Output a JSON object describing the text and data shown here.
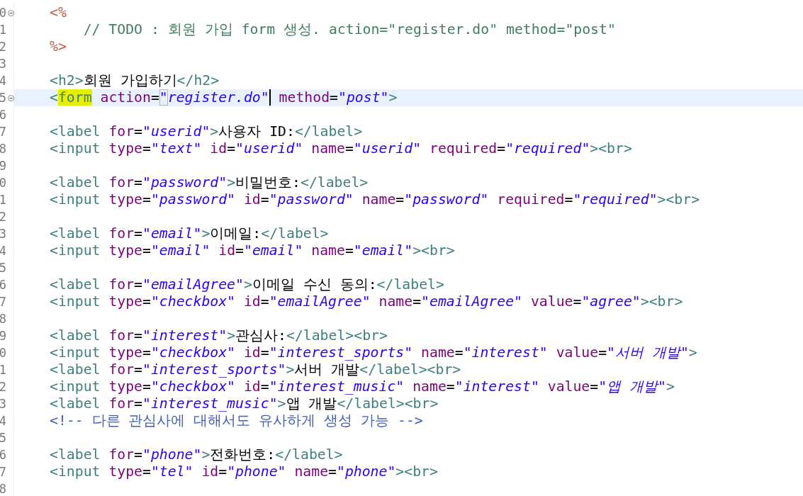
{
  "editor": {
    "lines": [
      {
        "number": "0",
        "fold": true,
        "current": false,
        "tokens": [
          {
            "kind": "jsp",
            "text": "<%"
          }
        ]
      },
      {
        "number": "1",
        "fold": false,
        "current": false,
        "tokens": [
          {
            "kind": "comment",
            "text": "    // TODO : 회원 가입 form 생성. action=\"register.do\" method=\"post\""
          }
        ]
      },
      {
        "number": "2",
        "fold": false,
        "current": false,
        "tokens": [
          {
            "kind": "jsp",
            "text": "%>"
          }
        ]
      },
      {
        "number": "3",
        "fold": false,
        "current": false
      },
      {
        "number": "4",
        "fold": false,
        "current": false,
        "tokens": [
          {
            "kind": "tag",
            "text": "<h2>"
          },
          {
            "kind": "text",
            "text": "회원 가입하기"
          },
          {
            "kind": "tag",
            "text": "</h2>"
          }
        ]
      },
      {
        "number": "5",
        "fold": true,
        "current": true,
        "tokens": [
          {
            "kind": "tag",
            "text": "<"
          },
          {
            "kind": "tag",
            "text": "form",
            "highlighted": true
          },
          {
            "kind": "attr",
            "text": " action"
          },
          {
            "kind": "text",
            "text": "="
          },
          {
            "kind": "value",
            "text": "\"",
            "boxed": true
          },
          {
            "kind": "value",
            "text": "register.do\"",
            "caret": true
          },
          {
            "kind": "attr",
            "text": " method"
          },
          {
            "kind": "text",
            "text": "="
          },
          {
            "kind": "value",
            "text": "\"post\""
          },
          {
            "kind": "tag",
            "text": ">"
          }
        ]
      },
      {
        "number": "6",
        "fold": false,
        "current": false
      },
      {
        "number": "7",
        "fold": false,
        "current": false,
        "tokens": [
          {
            "kind": "tag",
            "text": "<label"
          },
          {
            "kind": "attr",
            "text": " for"
          },
          {
            "kind": "text",
            "text": "="
          },
          {
            "kind": "value",
            "text": "\"userid\""
          },
          {
            "kind": "tag",
            "text": ">"
          },
          {
            "kind": "text",
            "text": "사용자 ID:"
          },
          {
            "kind": "tag",
            "text": "</label>"
          }
        ]
      },
      {
        "number": "8",
        "fold": false,
        "current": false,
        "tokens": [
          {
            "kind": "tag",
            "text": "<input"
          },
          {
            "kind": "attr",
            "text": " type"
          },
          {
            "kind": "text",
            "text": "="
          },
          {
            "kind": "value",
            "text": "\"text\""
          },
          {
            "kind": "attr",
            "text": " id"
          },
          {
            "kind": "text",
            "text": "="
          },
          {
            "kind": "value",
            "text": "\"userid\""
          },
          {
            "kind": "attr",
            "text": " name"
          },
          {
            "kind": "text",
            "text": "="
          },
          {
            "kind": "value",
            "text": "\"userid\""
          },
          {
            "kind": "attr",
            "text": " required"
          },
          {
            "kind": "text",
            "text": "="
          },
          {
            "kind": "value",
            "text": "\"required\""
          },
          {
            "kind": "tag",
            "text": "><br>"
          }
        ]
      },
      {
        "number": "9",
        "fold": false,
        "current": false
      },
      {
        "number": "0",
        "fold": false,
        "current": false,
        "tokens": [
          {
            "kind": "tag",
            "text": "<label"
          },
          {
            "kind": "attr",
            "text": " for"
          },
          {
            "kind": "text",
            "text": "="
          },
          {
            "kind": "value",
            "text": "\"password\""
          },
          {
            "kind": "tag",
            "text": ">"
          },
          {
            "kind": "text",
            "text": "비밀번호:"
          },
          {
            "kind": "tag",
            "text": "</label>"
          }
        ]
      },
      {
        "number": "1",
        "fold": false,
        "current": false,
        "tokens": [
          {
            "kind": "tag",
            "text": "<input"
          },
          {
            "kind": "attr",
            "text": " type"
          },
          {
            "kind": "text",
            "text": "="
          },
          {
            "kind": "value",
            "text": "\"password\""
          },
          {
            "kind": "attr",
            "text": " id"
          },
          {
            "kind": "text",
            "text": "="
          },
          {
            "kind": "value",
            "text": "\"password\""
          },
          {
            "kind": "attr",
            "text": " name"
          },
          {
            "kind": "text",
            "text": "="
          },
          {
            "kind": "value",
            "text": "\"password\""
          },
          {
            "kind": "attr",
            "text": " required"
          },
          {
            "kind": "text",
            "text": "="
          },
          {
            "kind": "value",
            "text": "\"required\""
          },
          {
            "kind": "tag",
            "text": "><br>"
          }
        ]
      },
      {
        "number": "2",
        "fold": false,
        "current": false
      },
      {
        "number": "3",
        "fold": false,
        "current": false,
        "tokens": [
          {
            "kind": "tag",
            "text": "<label"
          },
          {
            "kind": "attr",
            "text": " for"
          },
          {
            "kind": "text",
            "text": "="
          },
          {
            "kind": "value",
            "text": "\"email\""
          },
          {
            "kind": "tag",
            "text": ">"
          },
          {
            "kind": "text",
            "text": "이메일:"
          },
          {
            "kind": "tag",
            "text": "</label>"
          }
        ]
      },
      {
        "number": "4",
        "fold": false,
        "current": false,
        "tokens": [
          {
            "kind": "tag",
            "text": "<input"
          },
          {
            "kind": "attr",
            "text": " type"
          },
          {
            "kind": "text",
            "text": "="
          },
          {
            "kind": "value",
            "text": "\"email\""
          },
          {
            "kind": "attr",
            "text": " id"
          },
          {
            "kind": "text",
            "text": "="
          },
          {
            "kind": "value",
            "text": "\"email\""
          },
          {
            "kind": "attr",
            "text": " name"
          },
          {
            "kind": "text",
            "text": "="
          },
          {
            "kind": "value",
            "text": "\"email\""
          },
          {
            "kind": "tag",
            "text": "><br>"
          }
        ]
      },
      {
        "number": "5",
        "fold": false,
        "current": false
      },
      {
        "number": "6",
        "fold": false,
        "current": false,
        "tokens": [
          {
            "kind": "tag",
            "text": "<label"
          },
          {
            "kind": "attr",
            "text": " for"
          },
          {
            "kind": "text",
            "text": "="
          },
          {
            "kind": "value",
            "text": "\"emailAgree\""
          },
          {
            "kind": "tag",
            "text": ">"
          },
          {
            "kind": "text",
            "text": "이메일 수신 동의:"
          },
          {
            "kind": "tag",
            "text": "</label>"
          }
        ]
      },
      {
        "number": "7",
        "fold": false,
        "current": false,
        "tokens": [
          {
            "kind": "tag",
            "text": "<input"
          },
          {
            "kind": "attr",
            "text": " type"
          },
          {
            "kind": "text",
            "text": "="
          },
          {
            "kind": "value",
            "text": "\"checkbox\""
          },
          {
            "kind": "attr",
            "text": " id"
          },
          {
            "kind": "text",
            "text": "="
          },
          {
            "kind": "value",
            "text": "\"emailAgree\""
          },
          {
            "kind": "attr",
            "text": " name"
          },
          {
            "kind": "text",
            "text": "="
          },
          {
            "kind": "value",
            "text": "\"emailAgree\""
          },
          {
            "kind": "attr",
            "text": " value"
          },
          {
            "kind": "text",
            "text": "="
          },
          {
            "kind": "value",
            "text": "\"agree\""
          },
          {
            "kind": "tag",
            "text": "><br>"
          }
        ]
      },
      {
        "number": "8",
        "fold": false,
        "current": false
      },
      {
        "number": "9",
        "fold": false,
        "current": false,
        "tokens": [
          {
            "kind": "tag",
            "text": "<label"
          },
          {
            "kind": "attr",
            "text": " for"
          },
          {
            "kind": "text",
            "text": "="
          },
          {
            "kind": "value",
            "text": "\"interest\""
          },
          {
            "kind": "tag",
            "text": ">"
          },
          {
            "kind": "text",
            "text": "관심사:"
          },
          {
            "kind": "tag",
            "text": "</label><br>"
          }
        ]
      },
      {
        "number": "0",
        "fold": false,
        "current": false,
        "tokens": [
          {
            "kind": "tag",
            "text": "<input"
          },
          {
            "kind": "attr",
            "text": " type"
          },
          {
            "kind": "text",
            "text": "="
          },
          {
            "kind": "value",
            "text": "\"checkbox\""
          },
          {
            "kind": "attr",
            "text": " id"
          },
          {
            "kind": "text",
            "text": "="
          },
          {
            "kind": "value",
            "text": "\"interest_sports\""
          },
          {
            "kind": "attr",
            "text": " name"
          },
          {
            "kind": "text",
            "text": "="
          },
          {
            "kind": "value",
            "text": "\"interest\""
          },
          {
            "kind": "attr",
            "text": " value"
          },
          {
            "kind": "text",
            "text": "="
          },
          {
            "kind": "value",
            "text": "\"서버 개발\""
          },
          {
            "kind": "tag",
            "text": ">"
          }
        ]
      },
      {
        "number": "1",
        "fold": false,
        "current": false,
        "tokens": [
          {
            "kind": "tag",
            "text": "<label"
          },
          {
            "kind": "attr",
            "text": " for"
          },
          {
            "kind": "text",
            "text": "="
          },
          {
            "kind": "value",
            "text": "\"interest_sports\""
          },
          {
            "kind": "tag",
            "text": ">"
          },
          {
            "kind": "text",
            "text": "서버 개발"
          },
          {
            "kind": "tag",
            "text": "</label><br>"
          }
        ]
      },
      {
        "number": "2",
        "fold": false,
        "current": false,
        "tokens": [
          {
            "kind": "tag",
            "text": "<input"
          },
          {
            "kind": "attr",
            "text": " type"
          },
          {
            "kind": "text",
            "text": "="
          },
          {
            "kind": "value",
            "text": "\"checkbox\""
          },
          {
            "kind": "attr",
            "text": " id"
          },
          {
            "kind": "text",
            "text": "="
          },
          {
            "kind": "value",
            "text": "\"interest_music\""
          },
          {
            "kind": "attr",
            "text": " name"
          },
          {
            "kind": "text",
            "text": "="
          },
          {
            "kind": "value",
            "text": "\"interest\""
          },
          {
            "kind": "attr",
            "text": " value"
          },
          {
            "kind": "text",
            "text": "="
          },
          {
            "kind": "value",
            "text": "\"앱 개발\""
          },
          {
            "kind": "tag",
            "text": ">"
          }
        ]
      },
      {
        "number": "3",
        "fold": false,
        "current": false,
        "tokens": [
          {
            "kind": "tag",
            "text": "<label"
          },
          {
            "kind": "attr",
            "text": " for"
          },
          {
            "kind": "text",
            "text": "="
          },
          {
            "kind": "value",
            "text": "\"interest_music\""
          },
          {
            "kind": "tag",
            "text": ">"
          },
          {
            "kind": "text",
            "text": "앱 개발"
          },
          {
            "kind": "tag",
            "text": "</label><br>"
          }
        ]
      },
      {
        "number": "4",
        "fold": false,
        "current": false,
        "tokens": [
          {
            "kind": "htmlcomment",
            "text": "<!-- 다른 관심사에 대해서도 유사하게 생성 가능 -->"
          }
        ]
      },
      {
        "number": "5",
        "fold": false,
        "current": false
      },
      {
        "number": "6",
        "fold": false,
        "current": false,
        "tokens": [
          {
            "kind": "tag",
            "text": "<label"
          },
          {
            "kind": "attr",
            "text": " for"
          },
          {
            "kind": "text",
            "text": "="
          },
          {
            "kind": "value",
            "text": "\"phone\""
          },
          {
            "kind": "tag",
            "text": ">"
          },
          {
            "kind": "text",
            "text": "전화번호:"
          },
          {
            "kind": "tag",
            "text": "</label>"
          }
        ]
      },
      {
        "number": "7",
        "fold": false,
        "current": false,
        "tokens": [
          {
            "kind": "tag",
            "text": "<input"
          },
          {
            "kind": "attr",
            "text": " type"
          },
          {
            "kind": "text",
            "text": "="
          },
          {
            "kind": "value",
            "text": "\"tel\""
          },
          {
            "kind": "attr",
            "text": " id"
          },
          {
            "kind": "text",
            "text": "="
          },
          {
            "kind": "value",
            "text": "\"phone\""
          },
          {
            "kind": "attr",
            "text": " name"
          },
          {
            "kind": "text",
            "text": "="
          },
          {
            "kind": "value",
            "text": "\"phone\""
          },
          {
            "kind": "tag",
            "text": "><br>"
          }
        ]
      },
      {
        "number": "8",
        "fold": false,
        "current": false
      }
    ]
  }
}
